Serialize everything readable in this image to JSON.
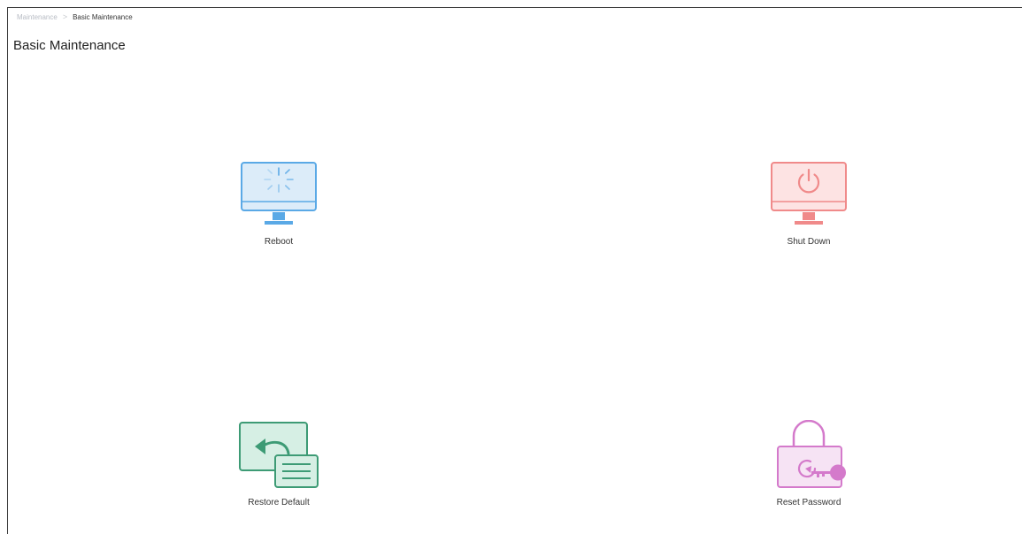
{
  "breadcrumb": {
    "parent": "Maintenance",
    "separator": ">",
    "current": "Basic Maintenance"
  },
  "page": {
    "title": "Basic Maintenance"
  },
  "tiles": [
    {
      "label": "Reboot",
      "icon": "reboot-monitor-icon",
      "color": "#5aa9e6"
    },
    {
      "label": "Shut Down",
      "icon": "shutdown-monitor-icon",
      "color": "#f08a8a"
    },
    {
      "label": "Restore Default",
      "icon": "restore-default-icon",
      "color": "#3d9b75"
    },
    {
      "label": "Reset Password",
      "icon": "reset-password-lock-icon",
      "color": "#d47acb"
    }
  ]
}
